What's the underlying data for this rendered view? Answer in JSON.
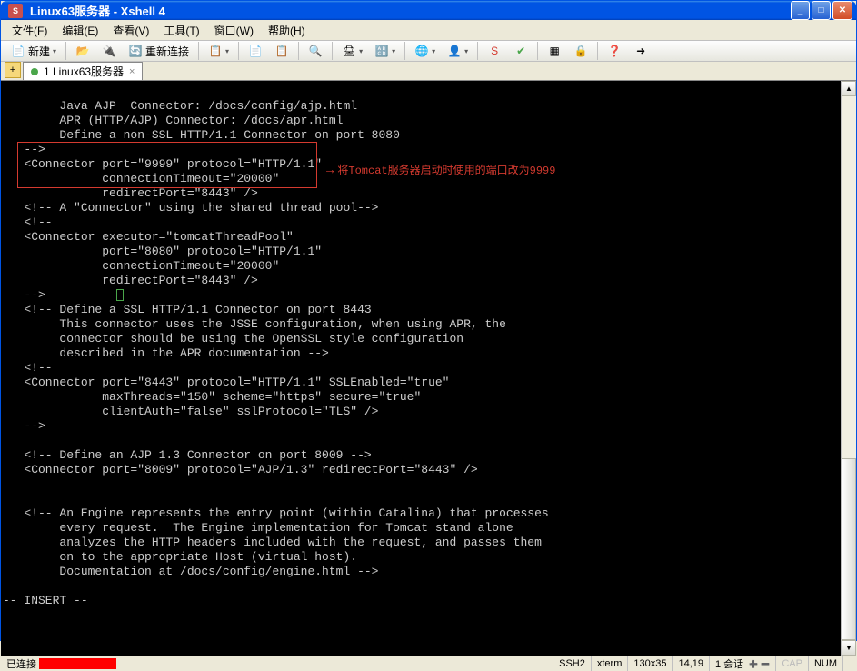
{
  "title": "Linux63服务器 - Xshell 4",
  "menu": {
    "file": "文件(F)",
    "edit": "编辑(E)",
    "view": "查看(V)",
    "tools": "工具(T)",
    "window": "窗口(W)",
    "help": "帮助(H)"
  },
  "toolbar": {
    "new": "新建",
    "reconnect": "重新连接"
  },
  "tab": {
    "label": "1 Linux63服务器"
  },
  "terminal": {
    "l1": "        Java AJP  Connector: /docs/config/ajp.html",
    "l2": "        APR (HTTP/AJP) Connector: /docs/apr.html",
    "l3": "        Define a non-SSL HTTP/1.1 Connector on port 8080",
    "l4": "   -->",
    "l5": "   <Connector port=\"9999\" protocol=\"HTTP/1.1\"",
    "l6": "              connectionTimeout=\"20000\"",
    "l7": "              redirectPort=\"8443\" />",
    "l8": "   <!-- A \"Connector\" using the shared thread pool-->",
    "l9": "   <!--",
    "l10": "   <Connector executor=\"tomcatThreadPool\"",
    "l11": "              port=\"8080\" protocol=\"HTTP/1.1\"",
    "l12": "              connectionTimeout=\"20000\"",
    "l13": "              redirectPort=\"8443\" />",
    "l14": "   -->",
    "l15": "   <!-- Define a SSL HTTP/1.1 Connector on port 8443",
    "l16": "        This connector uses the JSSE configuration, when using APR, the",
    "l17": "        connector should be using the OpenSSL style configuration",
    "l18": "        described in the APR documentation -->",
    "l19": "   <!--",
    "l20": "   <Connector port=\"8443\" protocol=\"HTTP/1.1\" SSLEnabled=\"true\"",
    "l21": "              maxThreads=\"150\" scheme=\"https\" secure=\"true\"",
    "l22": "              clientAuth=\"false\" sslProtocol=\"TLS\" />",
    "l23": "   -->",
    "l24": "",
    "l25": "   <!-- Define an AJP 1.3 Connector on port 8009 -->",
    "l26": "   <Connector port=\"8009\" protocol=\"AJP/1.3\" redirectPort=\"8443\" />",
    "l27": "",
    "l28": "",
    "l29": "   <!-- An Engine represents the entry point (within Catalina) that processes",
    "l30": "        every request.  The Engine implementation for Tomcat stand alone",
    "l31": "        analyzes the HTTP headers included with the request, and passes them",
    "l32": "        on to the appropriate Host (virtual host).",
    "l33": "        Documentation at /docs/config/engine.html -->",
    "l34": "",
    "l35": "-- INSERT --"
  },
  "annotation": "将Tomcat服务器启动时使用的端口改为9999",
  "status": {
    "connected": "已连接",
    "ssh": "SSH2",
    "term": "xterm",
    "size": "130x35",
    "pos": "14,19",
    "sessions": "1 会话",
    "cap": "CAP",
    "num": "NUM"
  }
}
